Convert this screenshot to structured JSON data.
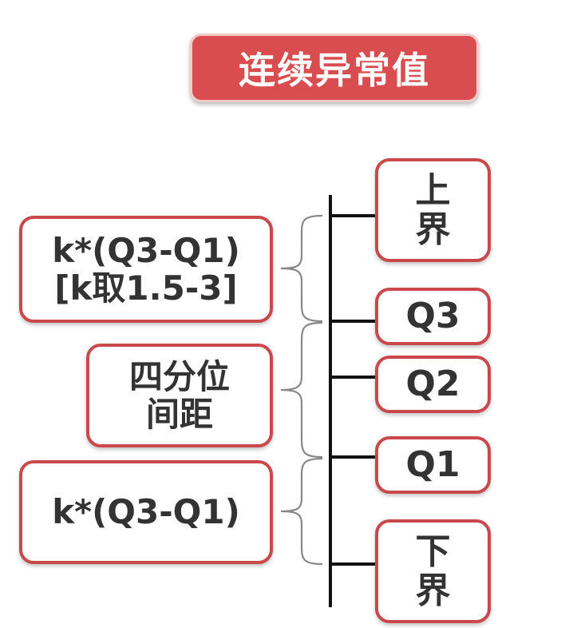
{
  "title": "连续异常值",
  "right_boxes": {
    "upper": {
      "lines": [
        "上",
        "界"
      ]
    },
    "q3": {
      "lines": [
        "Q3"
      ]
    },
    "q2": {
      "lines": [
        "Q2"
      ]
    },
    "q1": {
      "lines": [
        "Q1"
      ]
    },
    "lower": {
      "lines": [
        "下",
        "界"
      ]
    }
  },
  "left_boxes": {
    "upper_range": {
      "lines": [
        "k*(Q3-Q1)",
        "[k取1.5-3]"
      ]
    },
    "iqr": {
      "lines": [
        "四分位",
        "间距"
      ]
    },
    "lower_range": {
      "lines": [
        "k*(Q3-Q1)"
      ]
    }
  },
  "colors": {
    "title_fill": "#d94c4f",
    "box_border": "#c9484c",
    "text": "#333333",
    "line": "#111111"
  }
}
